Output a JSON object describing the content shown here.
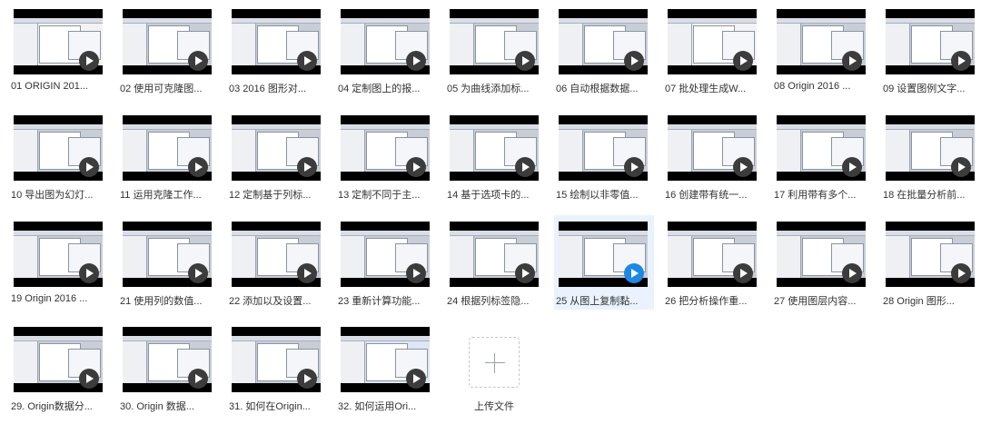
{
  "colors": {
    "accent": "#1e88e5",
    "selected_bg": "#eaf3fd",
    "text": "#333333"
  },
  "files": [
    {
      "label": "01 ORIGIN 201...",
      "variant": "white"
    },
    {
      "label": "02 使用可克隆图...",
      "variant": "app"
    },
    {
      "label": "03 2016 图形对...",
      "variant": "app"
    },
    {
      "label": "04 定制图上的报...",
      "variant": "app"
    },
    {
      "label": "05 为曲线添加标...",
      "variant": "app"
    },
    {
      "label": "06 自动根据数据...",
      "variant": "app"
    },
    {
      "label": "07 批处理生成W...",
      "variant": "white"
    },
    {
      "label": "08 Origin 2016 ...",
      "variant": "app"
    },
    {
      "label": "09 设置图例文字...",
      "variant": "app"
    },
    {
      "label": "10 导出图为幻灯...",
      "variant": "app"
    },
    {
      "label": "11 运用克隆工作...",
      "variant": "app"
    },
    {
      "label": "12 定制基于列标...",
      "variant": "app"
    },
    {
      "label": "13 定制不同于主...",
      "variant": "app"
    },
    {
      "label": "14 基于选项卡的...",
      "variant": "app"
    },
    {
      "label": "15 绘制以非零值...",
      "variant": "app"
    },
    {
      "label": "16 创建带有统一...",
      "variant": "app"
    },
    {
      "label": "17 利用带有多个...",
      "variant": "app"
    },
    {
      "label": "18 在批量分析前...",
      "variant": "app"
    },
    {
      "label": "19 Origin 2016 ...",
      "variant": "app"
    },
    {
      "label": "21 使用列的数值...",
      "variant": "app"
    },
    {
      "label": "22 添加以及设置...",
      "variant": "app"
    },
    {
      "label": "23 重新计算功能...",
      "variant": "app"
    },
    {
      "label": "24 根据列标签隐...",
      "variant": "app"
    },
    {
      "label": "25 从图上复制黏...",
      "variant": "app",
      "selected": true
    },
    {
      "label": "26 把分析操作重...",
      "variant": "app"
    },
    {
      "label": "27 使用图层内容...",
      "variant": "app"
    },
    {
      "label": "28 Origin 图形...",
      "variant": "app"
    },
    {
      "label": "29. Origin数据分...",
      "variant": "app"
    },
    {
      "label": "30. Origin 数据...",
      "variant": "app"
    },
    {
      "label": "31. 如何在Origin...",
      "variant": "app"
    },
    {
      "label": "32. 如何运用Ori...",
      "variant": "blue"
    }
  ],
  "upload": {
    "label": "上传文件",
    "icon": "plus-icon"
  }
}
